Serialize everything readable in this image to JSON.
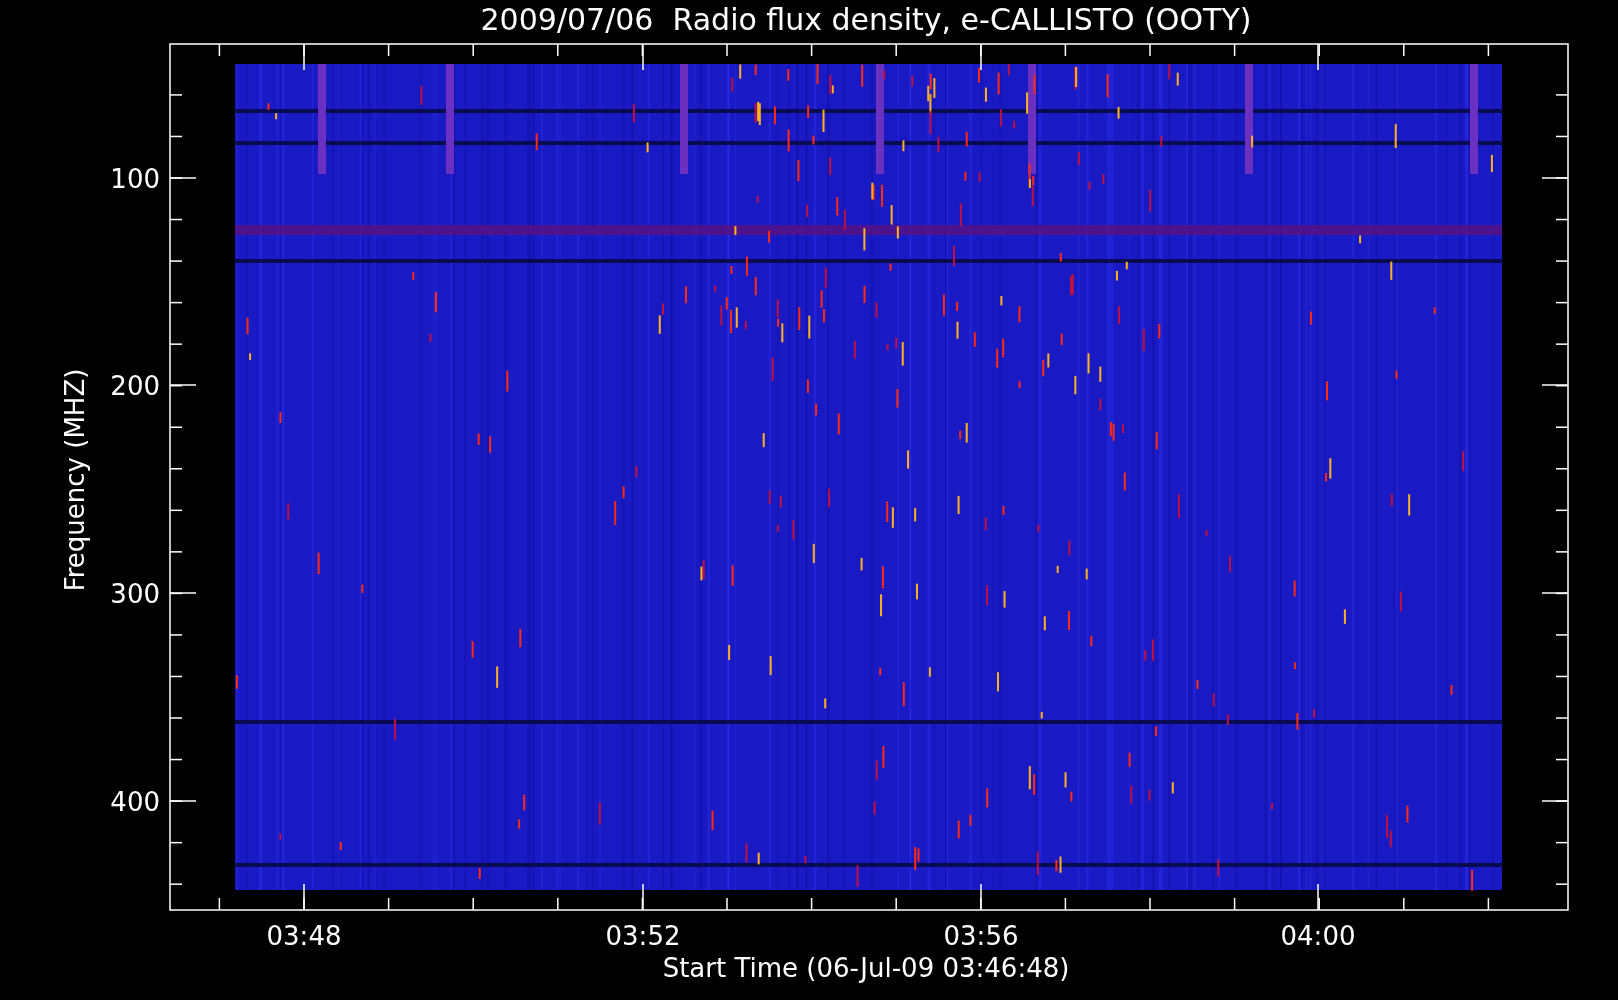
{
  "title": "2009/07/06  Radio flux density, e-CALLISTO (OOTY)",
  "y_axis": {
    "label": "Frequency (MHZ)",
    "ticks": [
      "100",
      "200",
      "300",
      "400"
    ]
  },
  "x_axis": {
    "label": "Start Time (06-Jul-09 03:46:48)",
    "ticks": [
      "03:48",
      "03:52",
      "03:56",
      "04:00"
    ]
  }
}
